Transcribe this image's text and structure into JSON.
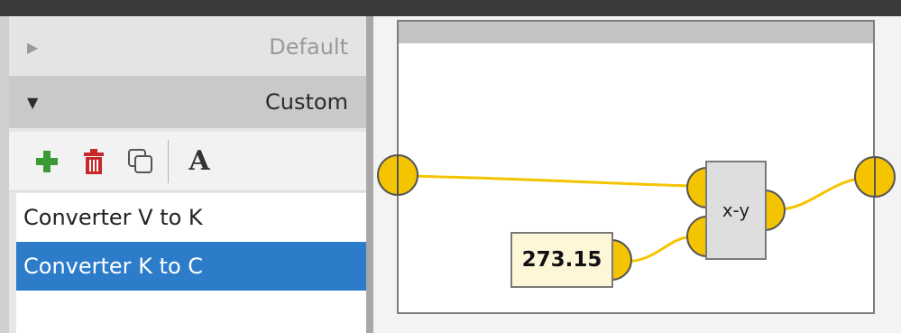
{
  "sidebar": {
    "sections": [
      {
        "label": "Default",
        "expanded": false
      },
      {
        "label": "Custom",
        "expanded": true
      }
    ],
    "toolbar": {
      "icons": [
        "add-icon",
        "delete-icon",
        "copy-icon",
        "rename-icon"
      ],
      "rename_glyph": "A"
    },
    "items": [
      {
        "label": "Converter V to K",
        "selected": false
      },
      {
        "label": "Converter K to C",
        "selected": true
      }
    ]
  },
  "canvas": {
    "constant_value": "273.15",
    "operator_label": "x-y",
    "wire_color": "#f5c400",
    "port_color": "#f5c400"
  },
  "colors": {
    "selection": "#2d7cc9",
    "add": "#3a9b35",
    "delete": "#c8282a"
  }
}
